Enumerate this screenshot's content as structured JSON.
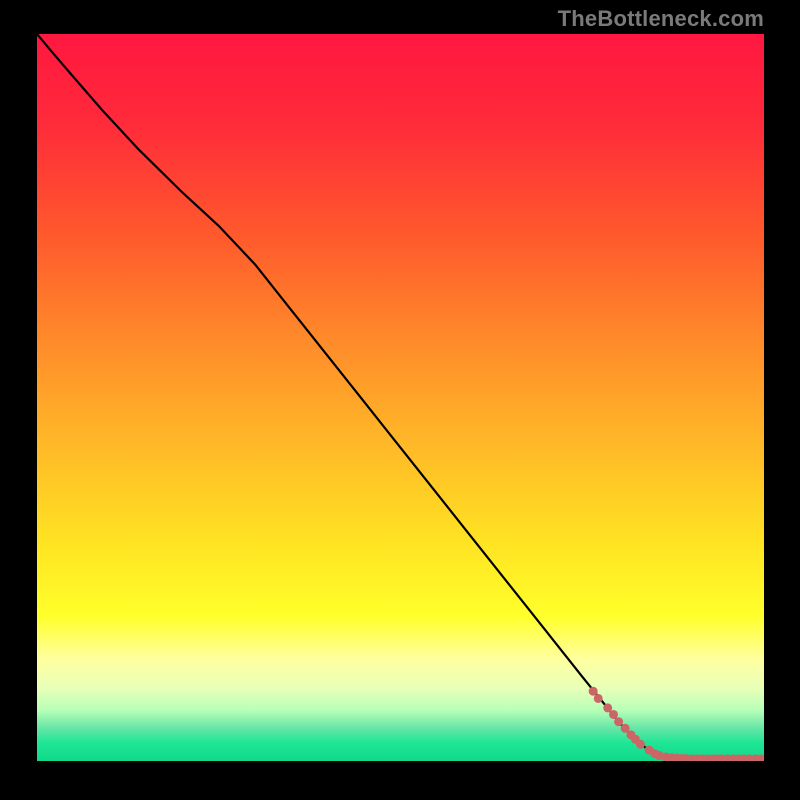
{
  "watermark": "TheBottleneck.com",
  "chart_data": {
    "type": "line",
    "title": "",
    "xlabel": "",
    "ylabel": "",
    "xlim": [
      0,
      100
    ],
    "ylim": [
      0,
      100
    ],
    "grid": false,
    "legend": false,
    "background_gradient": {
      "stops": [
        {
          "pos": 0.0,
          "color": "#ff1740"
        },
        {
          "pos": 0.12,
          "color": "#ff2a3a"
        },
        {
          "pos": 0.28,
          "color": "#ff5a2c"
        },
        {
          "pos": 0.42,
          "color": "#ff8a2a"
        },
        {
          "pos": 0.56,
          "color": "#ffb728"
        },
        {
          "pos": 0.7,
          "color": "#ffe322"
        },
        {
          "pos": 0.8,
          "color": "#ffff2a"
        },
        {
          "pos": 0.86,
          "color": "#ffffa0"
        },
        {
          "pos": 0.9,
          "color": "#e8ffb8"
        },
        {
          "pos": 0.93,
          "color": "#b8ffb8"
        },
        {
          "pos": 0.955,
          "color": "#66e6a6"
        },
        {
          "pos": 0.975,
          "color": "#1fe695"
        },
        {
          "pos": 1.0,
          "color": "#0fd98a"
        }
      ]
    },
    "series": [
      {
        "name": "curve",
        "type": "line",
        "color": "#000000",
        "width": 2.2,
        "x": [
          0,
          2,
          5,
          9,
          14,
          20,
          25,
          30,
          35,
          40,
          45,
          50,
          55,
          60,
          65,
          70,
          75,
          77.5,
          80,
          82,
          84,
          85.5
        ],
        "y": [
          100,
          97.6,
          94.1,
          89.5,
          84.1,
          78.2,
          73.6,
          68.3,
          62.0,
          55.7,
          49.4,
          43.1,
          36.8,
          30.5,
          24.2,
          17.9,
          11.6,
          8.5,
          5.4,
          3.2,
          1.6,
          0.6
        ]
      },
      {
        "name": "points",
        "type": "scatter",
        "color": "#cc6666",
        "radius_px": 4.5,
        "x": [
          76.5,
          77.2,
          78.5,
          79.3,
          80.0,
          80.9,
          81.7,
          82.3,
          83.0,
          84.2,
          85.0,
          85.6,
          86.5,
          87.3,
          88.0,
          88.7,
          89.3,
          90.1,
          90.8,
          91.5,
          92.2,
          93.0,
          93.6,
          94.2,
          95.0,
          95.8,
          96.5,
          97.2,
          98.0,
          98.8,
          99.6
        ],
        "y": [
          9.6,
          8.6,
          7.3,
          6.4,
          5.4,
          4.5,
          3.6,
          3.0,
          2.3,
          1.5,
          1.0,
          0.75,
          0.55,
          0.45,
          0.4,
          0.35,
          0.32,
          0.3,
          0.3,
          0.3,
          0.3,
          0.3,
          0.3,
          0.3,
          0.3,
          0.3,
          0.3,
          0.3,
          0.3,
          0.3,
          0.3
        ]
      }
    ]
  }
}
